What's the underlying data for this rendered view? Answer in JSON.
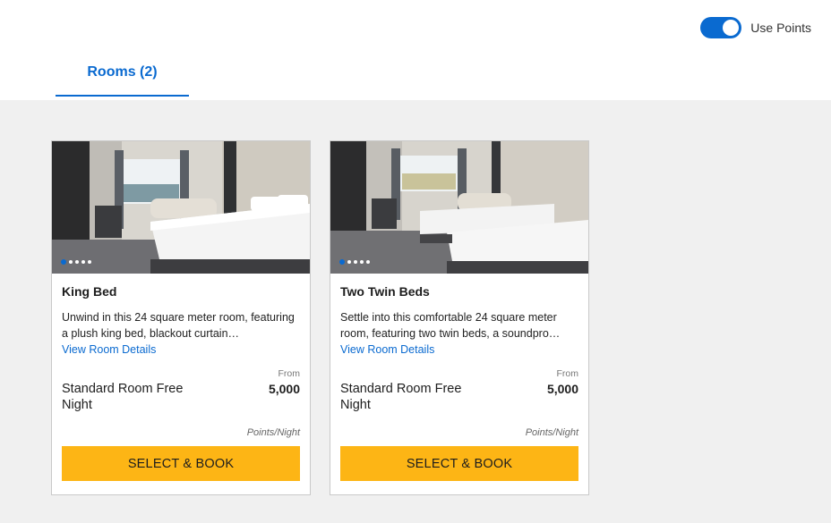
{
  "header": {
    "use_points_label": "Use Points",
    "use_points_on": true,
    "toggle_color": "#0a6ad0"
  },
  "tabs": [
    {
      "label": "Rooms (2)",
      "active": true
    }
  ],
  "rooms": [
    {
      "title": "King Bed",
      "description": "Unwind in this 24 square meter room, featuring a plush king bed, blackout curtain…",
      "details_link": "View Room Details",
      "from_label": "From",
      "points": "5,000",
      "rate_name": "Standard Room Free Night",
      "unit_label": "Points/Night",
      "button_label": "SELECT & BOOK",
      "image_count": 5,
      "active_image": 1
    },
    {
      "title": "Two Twin Beds",
      "description": "Settle into this comfortable 24 square meter room, featuring two twin beds, a soundpro…",
      "details_link": "View Room Details",
      "from_label": "From",
      "points": "5,000",
      "rate_name": "Standard Room Free Night",
      "unit_label": "Points/Night",
      "button_label": "SELECT & BOOK",
      "image_count": 5,
      "active_image": 1
    }
  ],
  "colors": {
    "accent": "#0a6ad0",
    "button": "#fdb515",
    "background": "#f0f0f0"
  }
}
